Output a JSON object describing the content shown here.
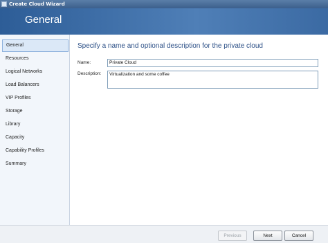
{
  "window": {
    "title": "Create Cloud Wizard"
  },
  "header": {
    "title": "General"
  },
  "sidebar": {
    "items": [
      {
        "label": "General"
      },
      {
        "label": "Resources"
      },
      {
        "label": "Logical Networks"
      },
      {
        "label": "Load Balancers"
      },
      {
        "label": "VIP Profiles"
      },
      {
        "label": "Storage"
      },
      {
        "label": "Library"
      },
      {
        "label": "Capacity"
      },
      {
        "label": "Capability Profiles"
      },
      {
        "label": "Summary"
      }
    ]
  },
  "main": {
    "heading": "Specify a name and optional description for the private cloud",
    "name_label": "Name:",
    "name_value": "Private Cloud",
    "description_label": "Description:",
    "description_value": "Virtualization and some coffee"
  },
  "footer": {
    "previous_label": "Previous",
    "next_label": "Next",
    "cancel_label": "Cancel"
  }
}
